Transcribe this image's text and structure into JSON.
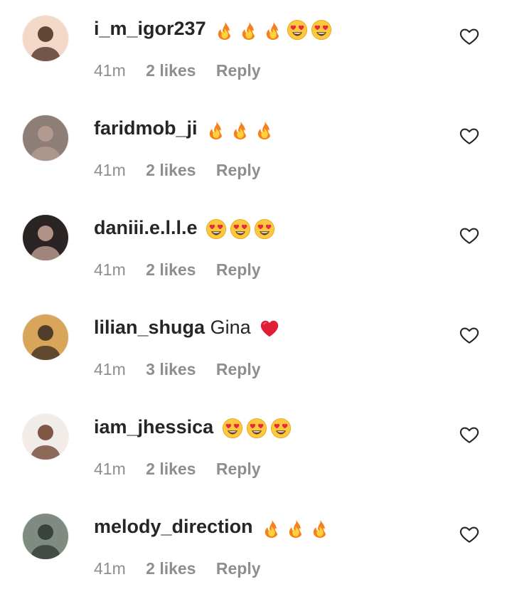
{
  "comments": [
    {
      "username": "i_m_igor237",
      "text": "",
      "emojis": [
        "fire",
        "fire",
        "fire",
        "heart-eyes",
        "heart-eyes"
      ],
      "time": "41m",
      "likes": "2 likes",
      "reply": "Reply",
      "avatar_colors": [
        "#f3d8c8",
        "#4a2a1f"
      ]
    },
    {
      "username": "faridmob_ji",
      "text": "",
      "emojis": [
        "fire",
        "fire",
        "fire"
      ],
      "time": "41m",
      "likes": "2 likes",
      "reply": "Reply",
      "avatar_colors": [
        "#8d7e78",
        "#b89f92"
      ]
    },
    {
      "username": "daniii.e.l.l.e",
      "text": "",
      "emojis": [
        "heart-eyes",
        "heart-eyes",
        "heart-eyes"
      ],
      "time": "41m",
      "likes": "2 likes",
      "reply": "Reply",
      "avatar_colors": [
        "#2a2424",
        "#c9a697"
      ]
    },
    {
      "username": "lilian_shuga",
      "text": "Gina",
      "emojis": [
        "red-heart"
      ],
      "time": "41m",
      "likes": "3 likes",
      "reply": "Reply",
      "avatar_colors": [
        "#d8a65a",
        "#3a2a22"
      ]
    },
    {
      "username": "iam_jhessica",
      "text": "",
      "emojis": [
        "heart-eyes",
        "heart-eyes",
        "heart-eyes"
      ],
      "time": "41m",
      "likes": "2 likes",
      "reply": "Reply",
      "avatar_colors": [
        "#f1ece8",
        "#6b3d2c"
      ]
    },
    {
      "username": "melody_direction",
      "text": "",
      "emojis": [
        "fire",
        "fire",
        "fire"
      ],
      "time": "41m",
      "likes": "2 likes",
      "reply": "Reply",
      "avatar_colors": [
        "#7f8a80",
        "#2e3530"
      ]
    }
  ],
  "icons": {
    "like": "heart-outline-icon"
  }
}
